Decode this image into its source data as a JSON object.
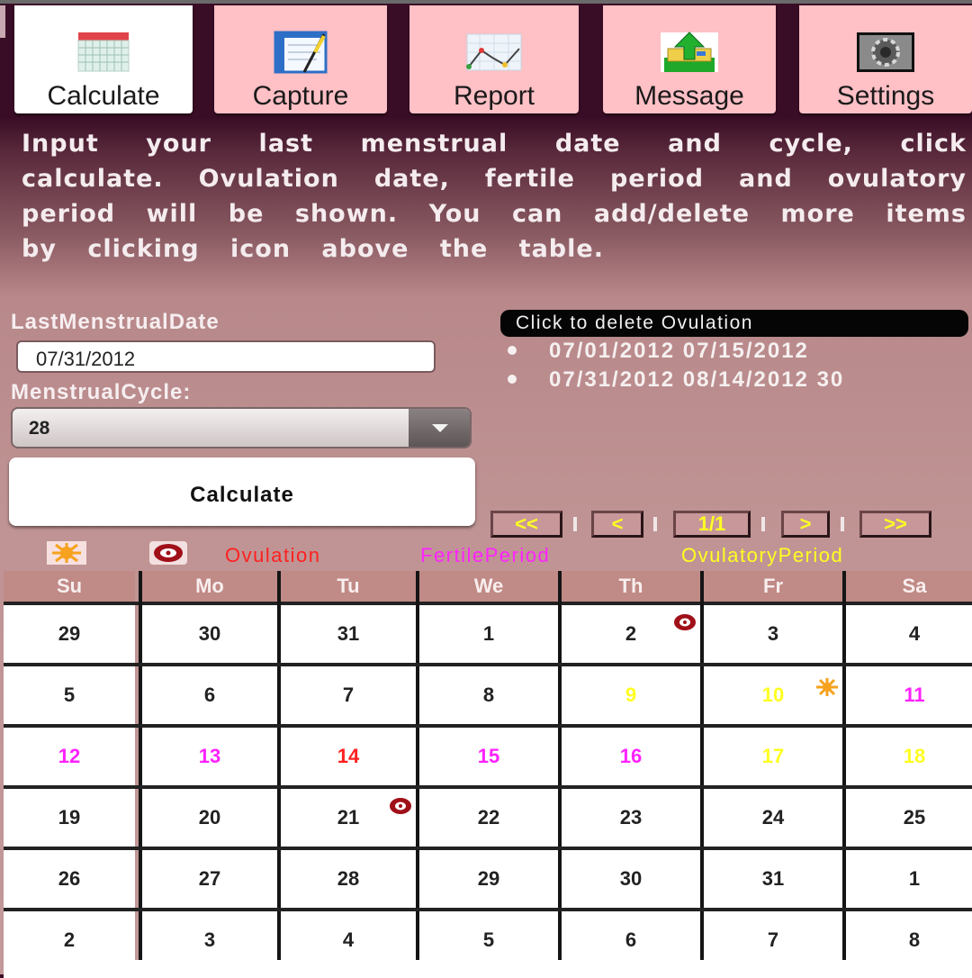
{
  "tabs": [
    {
      "label": "Calculate",
      "icon": "calendar-icon",
      "active": true
    },
    {
      "label": "Capture",
      "icon": "form-edit-icon",
      "active": false
    },
    {
      "label": "Report",
      "icon": "line-chart-icon",
      "active": false
    },
    {
      "label": "Message",
      "icon": "inbox-upload-icon",
      "active": false
    },
    {
      "label": "Settings",
      "icon": "gear-icon",
      "active": false
    }
  ],
  "intro": {
    "lines": [
      "Input your last menstrual date and cycle, click",
      "calculate. Ovulation date, fertile period and ovulatory",
      "period will be shown. You can add/delete more items",
      "by clicking icon above the table."
    ]
  },
  "form": {
    "last_date_label": "LastMenstrualDate",
    "last_date_value": "07/31/2012",
    "cycle_label": "MenstrualCycle:",
    "cycle_value": "28",
    "calculate_label": "Calculate"
  },
  "ovulation_list": {
    "delete_label": "Click to delete Ovulation",
    "items": [
      "07/01/2012 07/15/2012",
      "07/31/2012 08/14/2012 30"
    ]
  },
  "pager": {
    "first": "<<",
    "prev": "<",
    "page": "1/1",
    "next": ">",
    "last": ">>"
  },
  "legend": {
    "ovulation": "Ovulation",
    "fertile": "FertilePeriod",
    "ovulatory": "OvulatoryPeriod",
    "colors": {
      "ovulation": "#ff2020",
      "fertile": "#ff22ff",
      "ovulatory": "#ffff22",
      "normal": "#222222"
    }
  },
  "calendar": {
    "weekdays": [
      "Su",
      "Mo",
      "Tu",
      "We",
      "Th",
      "Fr",
      "Sa"
    ],
    "weeks": [
      [
        {
          "d": "29"
        },
        {
          "d": "30"
        },
        {
          "d": "31"
        },
        {
          "d": "1"
        },
        {
          "d": "2",
          "mark": "menstrual-start"
        },
        {
          "d": "3"
        },
        {
          "d": "4"
        }
      ],
      [
        {
          "d": "5"
        },
        {
          "d": "6"
        },
        {
          "d": "7"
        },
        {
          "d": "8"
        },
        {
          "d": "9",
          "type": "ovulatory"
        },
        {
          "d": "10",
          "type": "ovulatory",
          "mark": "ovulation-sun"
        },
        {
          "d": "11",
          "type": "fertile"
        }
      ],
      [
        {
          "d": "12",
          "type": "fertile"
        },
        {
          "d": "13",
          "type": "fertile"
        },
        {
          "d": "14",
          "type": "ovulation"
        },
        {
          "d": "15",
          "type": "fertile"
        },
        {
          "d": "16",
          "type": "fertile"
        },
        {
          "d": "17",
          "type": "ovulatory"
        },
        {
          "d": "18",
          "type": "ovulatory"
        }
      ],
      [
        {
          "d": "19"
        },
        {
          "d": "20"
        },
        {
          "d": "21",
          "mark": "menstrual-start"
        },
        {
          "d": "22"
        },
        {
          "d": "23"
        },
        {
          "d": "24"
        },
        {
          "d": "25"
        }
      ],
      [
        {
          "d": "26"
        },
        {
          "d": "27"
        },
        {
          "d": "28"
        },
        {
          "d": "29"
        },
        {
          "d": "30"
        },
        {
          "d": "31"
        },
        {
          "d": "1"
        }
      ],
      [
        {
          "d": "2"
        },
        {
          "d": "3"
        },
        {
          "d": "4"
        },
        {
          "d": "5"
        },
        {
          "d": "6"
        },
        {
          "d": "7"
        },
        {
          "d": "8"
        }
      ]
    ]
  }
}
